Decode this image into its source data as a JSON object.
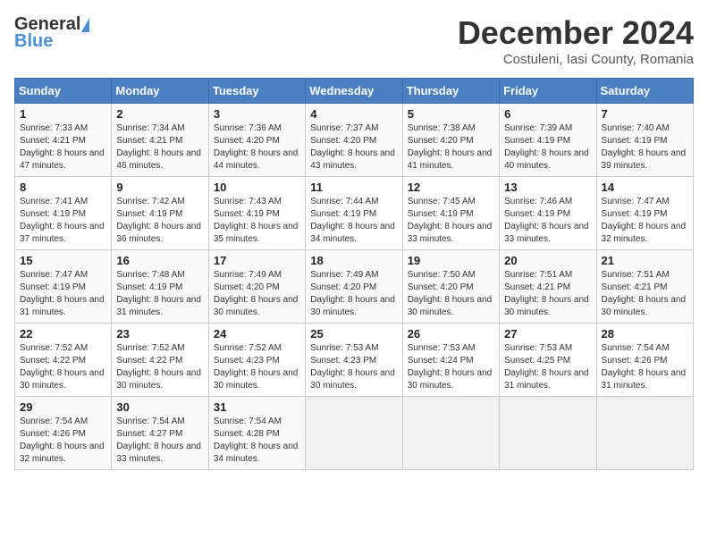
{
  "header": {
    "logo_general": "General",
    "logo_blue": "Blue",
    "month_title": "December 2024",
    "location": "Costuleni, Iasi County, Romania"
  },
  "days_of_week": [
    "Sunday",
    "Monday",
    "Tuesday",
    "Wednesday",
    "Thursday",
    "Friday",
    "Saturday"
  ],
  "weeks": [
    [
      {
        "day": "1",
        "sunrise": "Sunrise: 7:33 AM",
        "sunset": "Sunset: 4:21 PM",
        "daylight": "Daylight: 8 hours and 47 minutes."
      },
      {
        "day": "2",
        "sunrise": "Sunrise: 7:34 AM",
        "sunset": "Sunset: 4:21 PM",
        "daylight": "Daylight: 8 hours and 46 minutes."
      },
      {
        "day": "3",
        "sunrise": "Sunrise: 7:36 AM",
        "sunset": "Sunset: 4:20 PM",
        "daylight": "Daylight: 8 hours and 44 minutes."
      },
      {
        "day": "4",
        "sunrise": "Sunrise: 7:37 AM",
        "sunset": "Sunset: 4:20 PM",
        "daylight": "Daylight: 8 hours and 43 minutes."
      },
      {
        "day": "5",
        "sunrise": "Sunrise: 7:38 AM",
        "sunset": "Sunset: 4:20 PM",
        "daylight": "Daylight: 8 hours and 41 minutes."
      },
      {
        "day": "6",
        "sunrise": "Sunrise: 7:39 AM",
        "sunset": "Sunset: 4:19 PM",
        "daylight": "Daylight: 8 hours and 40 minutes."
      },
      {
        "day": "7",
        "sunrise": "Sunrise: 7:40 AM",
        "sunset": "Sunset: 4:19 PM",
        "daylight": "Daylight: 8 hours and 39 minutes."
      }
    ],
    [
      {
        "day": "8",
        "sunrise": "Sunrise: 7:41 AM",
        "sunset": "Sunset: 4:19 PM",
        "daylight": "Daylight: 8 hours and 37 minutes."
      },
      {
        "day": "9",
        "sunrise": "Sunrise: 7:42 AM",
        "sunset": "Sunset: 4:19 PM",
        "daylight": "Daylight: 8 hours and 36 minutes."
      },
      {
        "day": "10",
        "sunrise": "Sunrise: 7:43 AM",
        "sunset": "Sunset: 4:19 PM",
        "daylight": "Daylight: 8 hours and 35 minutes."
      },
      {
        "day": "11",
        "sunrise": "Sunrise: 7:44 AM",
        "sunset": "Sunset: 4:19 PM",
        "daylight": "Daylight: 8 hours and 34 minutes."
      },
      {
        "day": "12",
        "sunrise": "Sunrise: 7:45 AM",
        "sunset": "Sunset: 4:19 PM",
        "daylight": "Daylight: 8 hours and 33 minutes."
      },
      {
        "day": "13",
        "sunrise": "Sunrise: 7:46 AM",
        "sunset": "Sunset: 4:19 PM",
        "daylight": "Daylight: 8 hours and 33 minutes."
      },
      {
        "day": "14",
        "sunrise": "Sunrise: 7:47 AM",
        "sunset": "Sunset: 4:19 PM",
        "daylight": "Daylight: 8 hours and 32 minutes."
      }
    ],
    [
      {
        "day": "15",
        "sunrise": "Sunrise: 7:47 AM",
        "sunset": "Sunset: 4:19 PM",
        "daylight": "Daylight: 8 hours and 31 minutes."
      },
      {
        "day": "16",
        "sunrise": "Sunrise: 7:48 AM",
        "sunset": "Sunset: 4:19 PM",
        "daylight": "Daylight: 8 hours and 31 minutes."
      },
      {
        "day": "17",
        "sunrise": "Sunrise: 7:49 AM",
        "sunset": "Sunset: 4:20 PM",
        "daylight": "Daylight: 8 hours and 30 minutes."
      },
      {
        "day": "18",
        "sunrise": "Sunrise: 7:49 AM",
        "sunset": "Sunset: 4:20 PM",
        "daylight": "Daylight: 8 hours and 30 minutes."
      },
      {
        "day": "19",
        "sunrise": "Sunrise: 7:50 AM",
        "sunset": "Sunset: 4:20 PM",
        "daylight": "Daylight: 8 hours and 30 minutes."
      },
      {
        "day": "20",
        "sunrise": "Sunrise: 7:51 AM",
        "sunset": "Sunset: 4:21 PM",
        "daylight": "Daylight: 8 hours and 30 minutes."
      },
      {
        "day": "21",
        "sunrise": "Sunrise: 7:51 AM",
        "sunset": "Sunset: 4:21 PM",
        "daylight": "Daylight: 8 hours and 30 minutes."
      }
    ],
    [
      {
        "day": "22",
        "sunrise": "Sunrise: 7:52 AM",
        "sunset": "Sunset: 4:22 PM",
        "daylight": "Daylight: 8 hours and 30 minutes."
      },
      {
        "day": "23",
        "sunrise": "Sunrise: 7:52 AM",
        "sunset": "Sunset: 4:22 PM",
        "daylight": "Daylight: 8 hours and 30 minutes."
      },
      {
        "day": "24",
        "sunrise": "Sunrise: 7:52 AM",
        "sunset": "Sunset: 4:23 PM",
        "daylight": "Daylight: 8 hours and 30 minutes."
      },
      {
        "day": "25",
        "sunrise": "Sunrise: 7:53 AM",
        "sunset": "Sunset: 4:23 PM",
        "daylight": "Daylight: 8 hours and 30 minutes."
      },
      {
        "day": "26",
        "sunrise": "Sunrise: 7:53 AM",
        "sunset": "Sunset: 4:24 PM",
        "daylight": "Daylight: 8 hours and 30 minutes."
      },
      {
        "day": "27",
        "sunrise": "Sunrise: 7:53 AM",
        "sunset": "Sunset: 4:25 PM",
        "daylight": "Daylight: 8 hours and 31 minutes."
      },
      {
        "day": "28",
        "sunrise": "Sunrise: 7:54 AM",
        "sunset": "Sunset: 4:26 PM",
        "daylight": "Daylight: 8 hours and 31 minutes."
      }
    ],
    [
      {
        "day": "29",
        "sunrise": "Sunrise: 7:54 AM",
        "sunset": "Sunset: 4:26 PM",
        "daylight": "Daylight: 8 hours and 32 minutes."
      },
      {
        "day": "30",
        "sunrise": "Sunrise: 7:54 AM",
        "sunset": "Sunset: 4:27 PM",
        "daylight": "Daylight: 8 hours and 33 minutes."
      },
      {
        "day": "31",
        "sunrise": "Sunrise: 7:54 AM",
        "sunset": "Sunset: 4:28 PM",
        "daylight": "Daylight: 8 hours and 34 minutes."
      },
      null,
      null,
      null,
      null
    ]
  ]
}
